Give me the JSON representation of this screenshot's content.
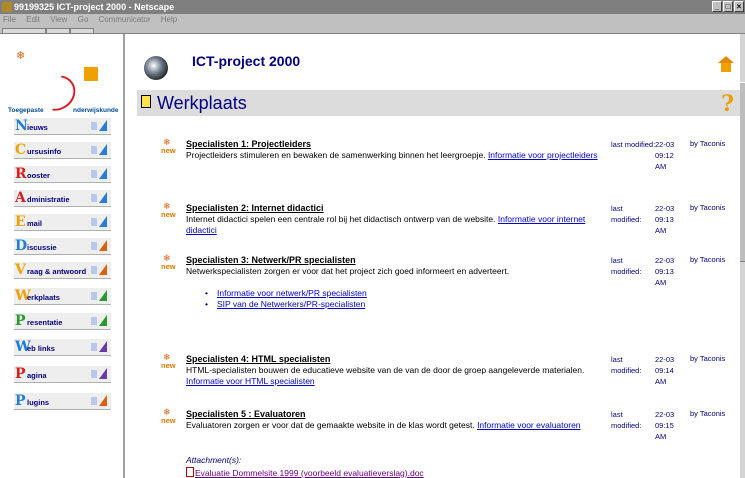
{
  "window": {
    "title": "99199325 ICT-project 2000 - Netscape",
    "controls": [
      "_",
      "□",
      "×"
    ]
  },
  "menubar": [
    "File",
    "Edit",
    "View",
    "Go",
    "Communicator",
    "Help"
  ],
  "logo": {
    "text_left": "Toegepaste",
    "text_right": "nderwijskunde",
    "swoosh_letter": "O"
  },
  "nav": {
    "items": [
      {
        "first": "N",
        "rest": "ieuws",
        "color": "#1f7fd6"
      },
      {
        "first": "C",
        "rest": "ursusinfo",
        "color": "#f0a000"
      },
      {
        "first": "R",
        "rest": "ooster",
        "color": "#d62020"
      },
      {
        "first": "A",
        "rest": "dministratie",
        "color": "#d62020"
      },
      {
        "first": "E",
        "rest": "mail",
        "color": "#f0a000"
      },
      {
        "first": "D",
        "rest": "iscussie",
        "color": "#1f7fd6"
      },
      {
        "first": "V",
        "rest": "raag & antwoord",
        "color": "#f0a000"
      },
      {
        "first": "W",
        "rest": "erkplaats",
        "color": "#f0a000"
      },
      {
        "first": "P",
        "rest": "resentatie",
        "color": "#2a9a30"
      },
      {
        "first": "W",
        "rest": "eb links",
        "color": "#1f7fd6"
      },
      {
        "first": "P",
        "rest": "agina",
        "color": "#d62020"
      },
      {
        "first": "P",
        "rest": "lugins",
        "color": "#1f7fd6"
      }
    ]
  },
  "header": {
    "project_title": "ICT-project 2000",
    "heading": "Werkplaats",
    "help_symbol": "?"
  },
  "new_label": "new",
  "entries": [
    {
      "title": "Specialisten 1: Projectleiders",
      "desc": "Projectleiders stimuleren en bewaken de samenwerking binnen het leergroepje. ",
      "link": "Informatie voor projectleiders",
      "meta": "last modified:",
      "date": "22-03 09:12 AM",
      "by": "by Taconis"
    },
    {
      "title": "Specialisten 2: Internet didactici",
      "desc": "Internet didactici spelen een centrale rol bij het didactisch ontwerp van de website. ",
      "link": "Informatie voor internet didactici",
      "meta": "last modified:",
      "date": "22-03 09:13 AM",
      "by": "by Taconis"
    },
    {
      "title": "Specialisten 3: Netwerk/PR specialisten",
      "desc": "Netwerkspecialisten zorgen er voor dat het project zich goed informeert en adverteert.",
      "meta": "last modified:",
      "date": "22-03 09:13 AM",
      "by": "by Taconis",
      "sublinks": [
        "Informatie voor netwerk/PR specialisten",
        "SIP van de Netwerkers/PR-specialisten"
      ]
    },
    {
      "title": "Specialisten 4: HTML specialisten",
      "desc": "HTML-specialisten bouwen de educatieve website van de van de door de groep aangeleverde materialen. ",
      "link": "Informatie voor HTML specialisten",
      "meta": "last modified:",
      "date": "22-03 09:14 AM",
      "by": "by Taconis"
    },
    {
      "title": "Specialisten 5 : Evaluatoren",
      "desc": "Evaluatoren zorgen er voor dat de gemaakte website in de klas wordt getest. ",
      "link": "Informatie voor evaluatoren",
      "meta": "last modified:",
      "date": "22-03 09:15 AM",
      "by": "by Taconis",
      "attachment_label": "Attachment(s):",
      "attachment": "Evaluatie Dommelsite 1999 (voorbeeld evaluatieverslag).doc"
    }
  ]
}
